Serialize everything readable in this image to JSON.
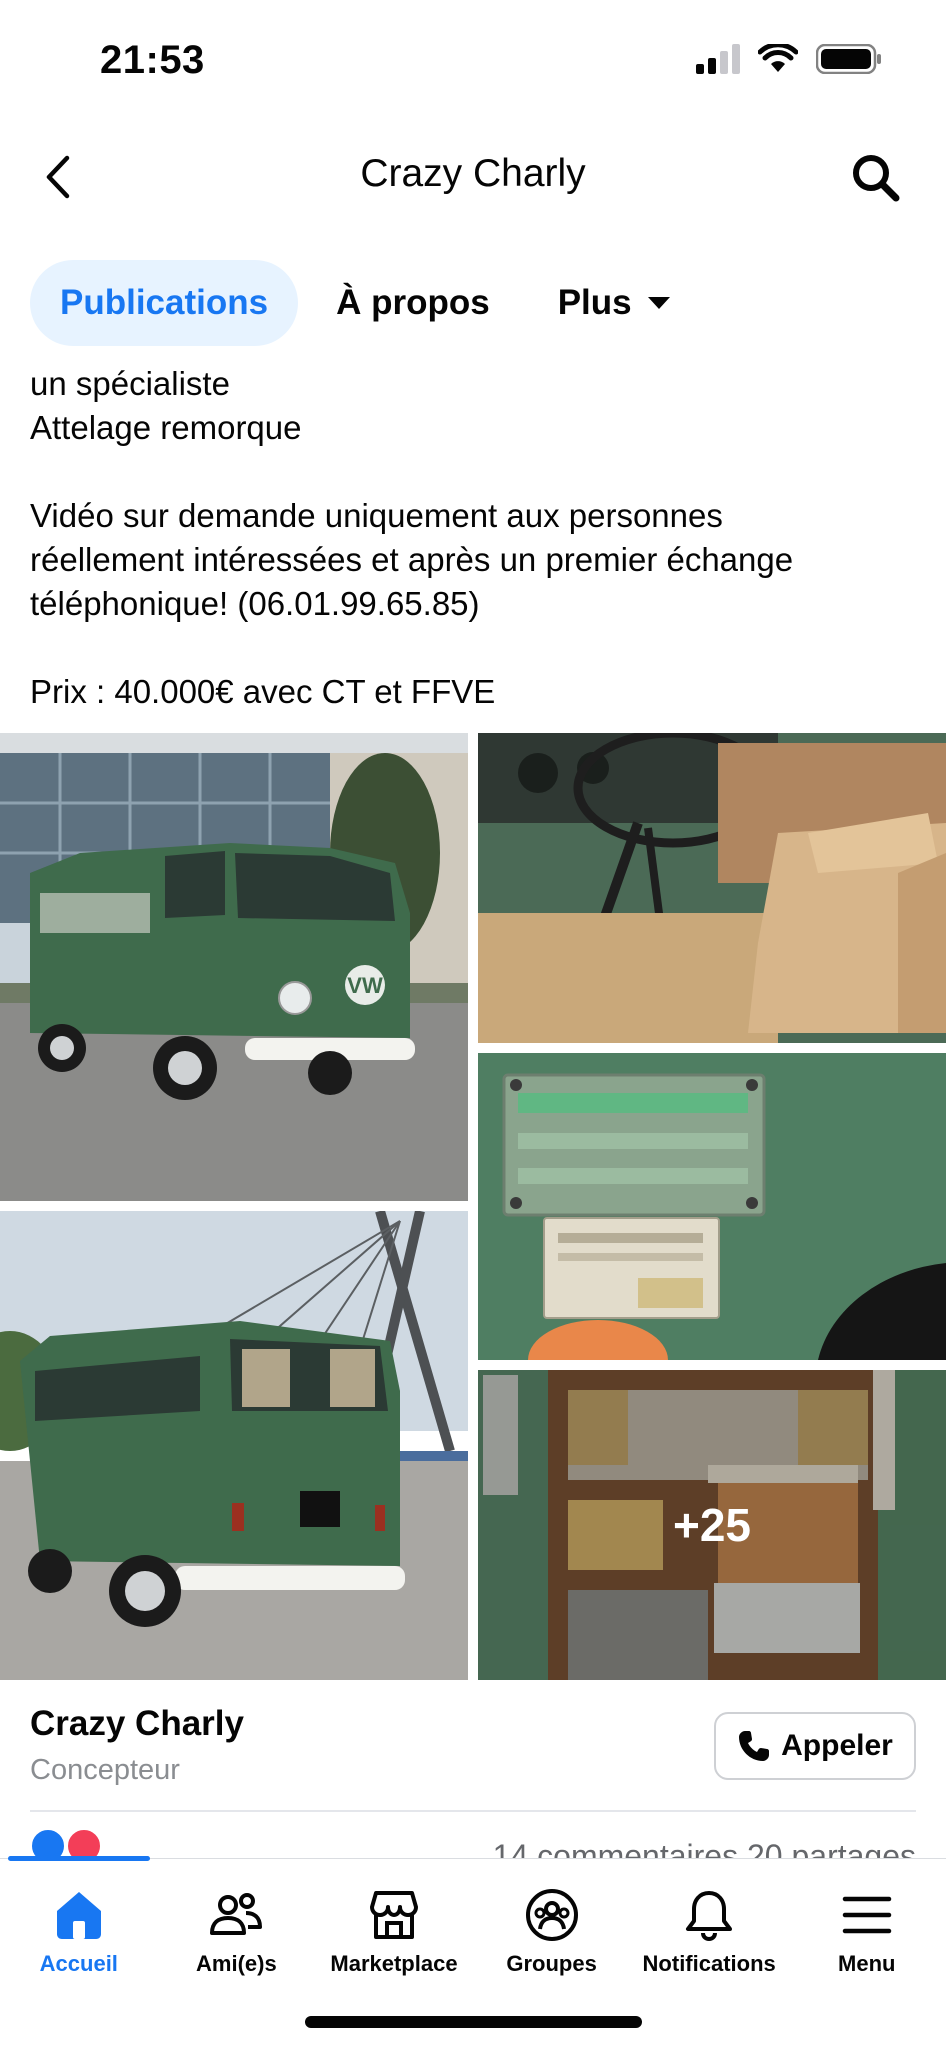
{
  "status_bar": {
    "time": "21:53"
  },
  "header": {
    "title": "Crazy Charly"
  },
  "tabs": [
    {
      "label": "Publications"
    },
    {
      "label": "À propos"
    },
    {
      "label": "Plus"
    }
  ],
  "post": {
    "lines": [
      "un spécialiste",
      "Attelage remorque",
      "",
      "Vidéo sur demande uniquement aux personnes",
      "réellement intéressées et après un premier échange",
      "téléphonique! (06.01.99.65.85)",
      "",
      "Prix : 40.000€ avec CT et FFVE"
    ],
    "more_photos": "+25"
  },
  "author": {
    "name": "Crazy Charly",
    "role": "Concepteur",
    "call_label": "Appeler"
  },
  "stats": {
    "text": "14 commentaires  20 partages"
  },
  "bottom_nav": [
    {
      "label": "Accueil",
      "icon": "home-icon"
    },
    {
      "label": "Ami(e)s",
      "icon": "friends-icon"
    },
    {
      "label": "Marketplace",
      "icon": "marketplace-icon"
    },
    {
      "label": "Groupes",
      "icon": "groups-icon"
    },
    {
      "label": "Notifications",
      "icon": "bell-icon"
    },
    {
      "label": "Menu",
      "icon": "menu-icon"
    }
  ],
  "colors": {
    "accent": "#1877f2",
    "tab_active_bg": "#e7f3ff",
    "van_green": "#3f6b4c",
    "secondary_text": "#65676b"
  }
}
